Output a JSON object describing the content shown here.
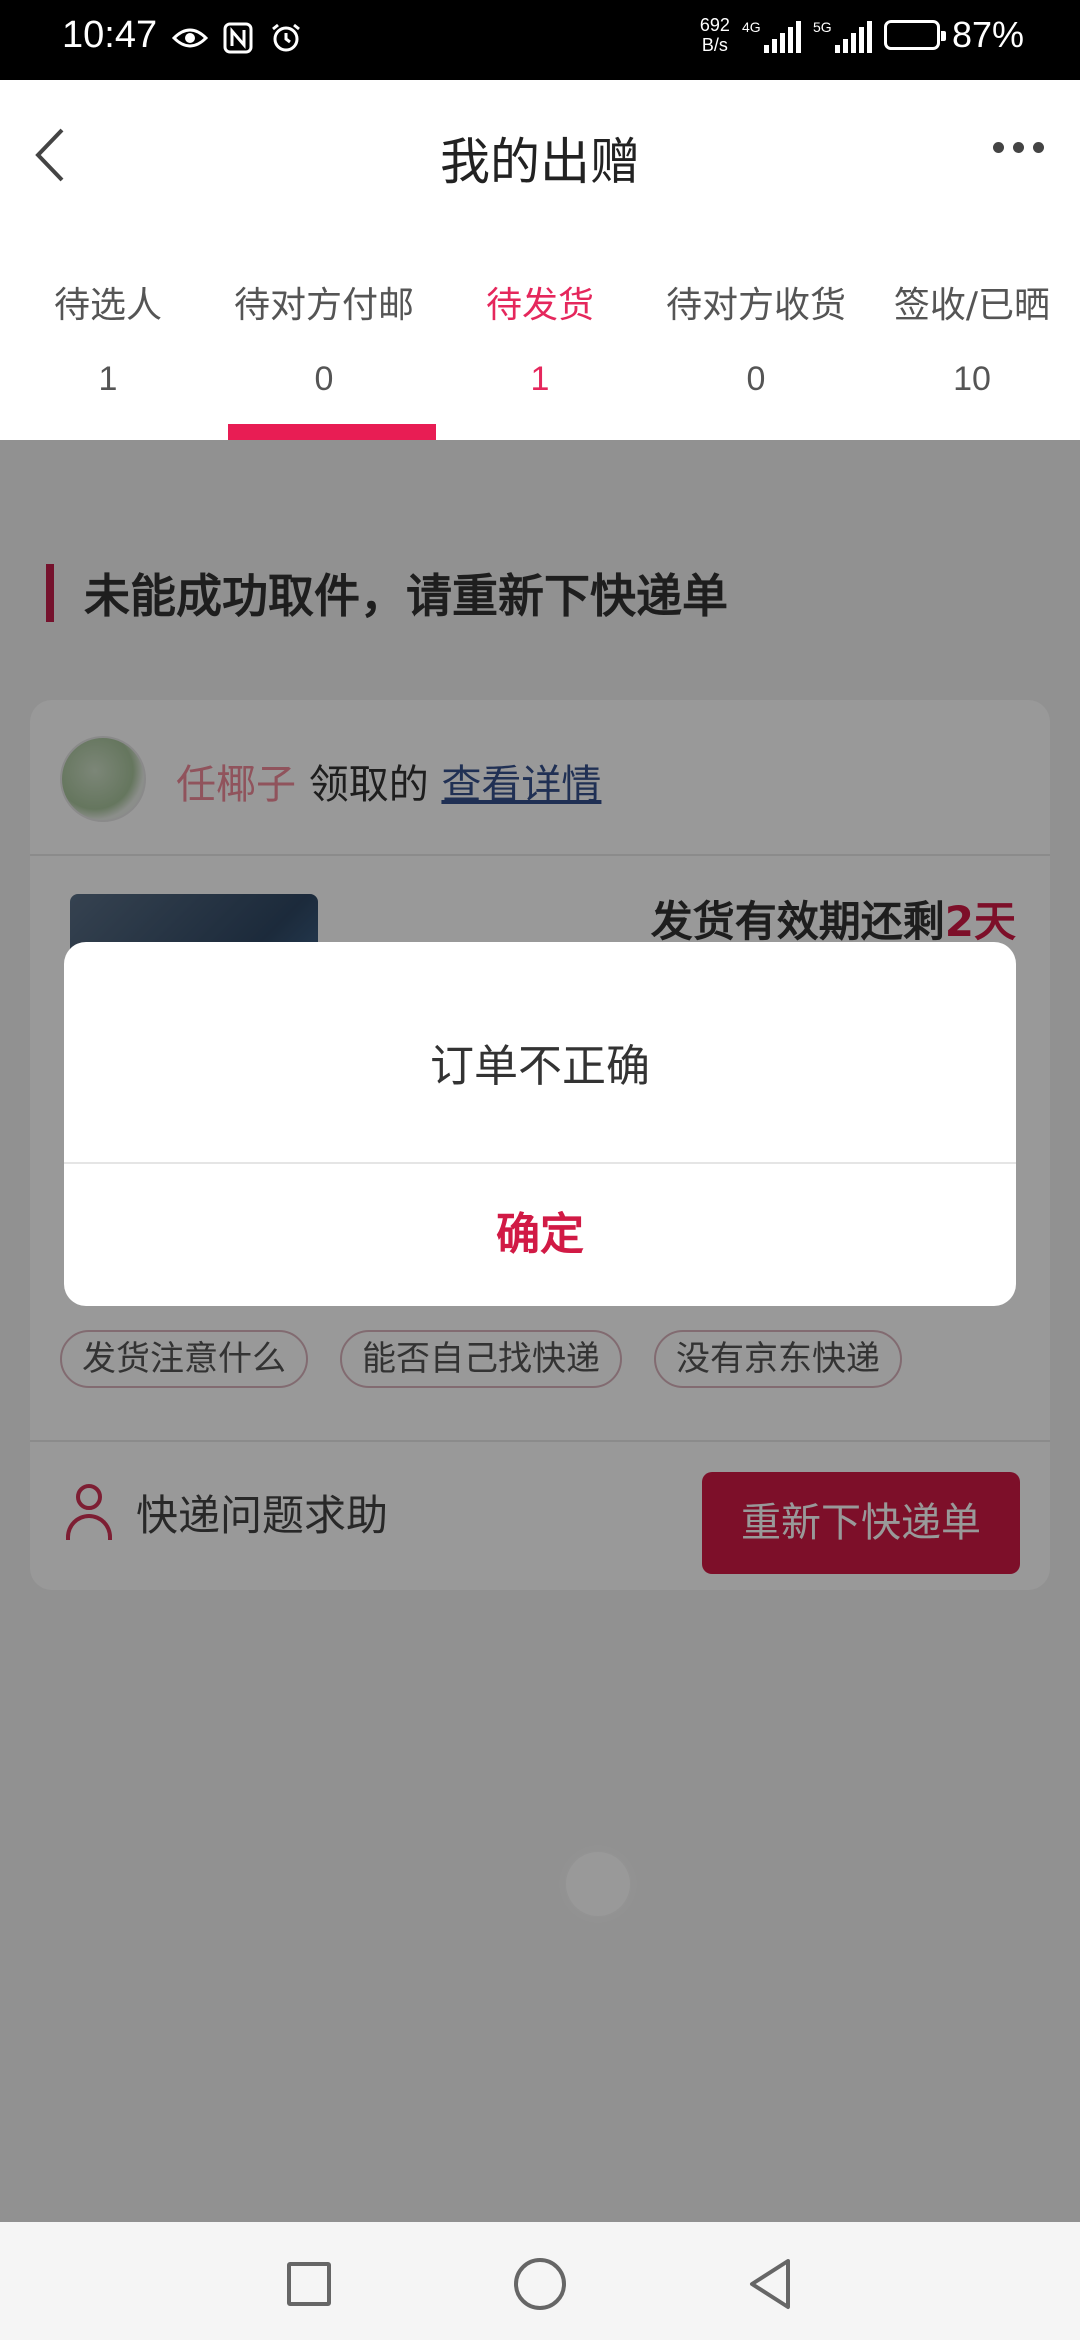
{
  "status_bar": {
    "time": "10:47",
    "net_speed_value": "692",
    "net_speed_unit": "B/s",
    "sim1_type": "4G",
    "sim2_type": "5G",
    "battery_percent": "87%",
    "battery_level": 0.87,
    "icons": [
      "eye-icon",
      "nfc-icon",
      "alarm-icon"
    ]
  },
  "header": {
    "title": "我的出赠"
  },
  "tabs": [
    {
      "label": "待选人",
      "count": "1",
      "active": false
    },
    {
      "label": "待对方付邮",
      "count": "0",
      "active": false
    },
    {
      "label": "待发货",
      "count": "1",
      "active": true
    },
    {
      "label": "待对方收货",
      "count": "0",
      "active": false
    },
    {
      "label": "签收/已晒",
      "count": "10",
      "active": false
    }
  ],
  "section": {
    "title": "未能成功取件，请重新下快递单"
  },
  "card": {
    "claimer_name": "任椰子",
    "claim_suffix": "领取的",
    "detail_link": "查看详情",
    "deadline_prefix": "发货有效期还剩",
    "deadline_value": "2天",
    "tags": [
      "发货注意什么",
      "能否自己找快递",
      "没有京东快递"
    ],
    "help_label": "快递问题求助",
    "reorder_button": "重新下快递单"
  },
  "dialog": {
    "message": "订单不正确",
    "confirm": "确定"
  },
  "colors": {
    "accent": "#e81d54",
    "button_red": "#d11a45"
  }
}
